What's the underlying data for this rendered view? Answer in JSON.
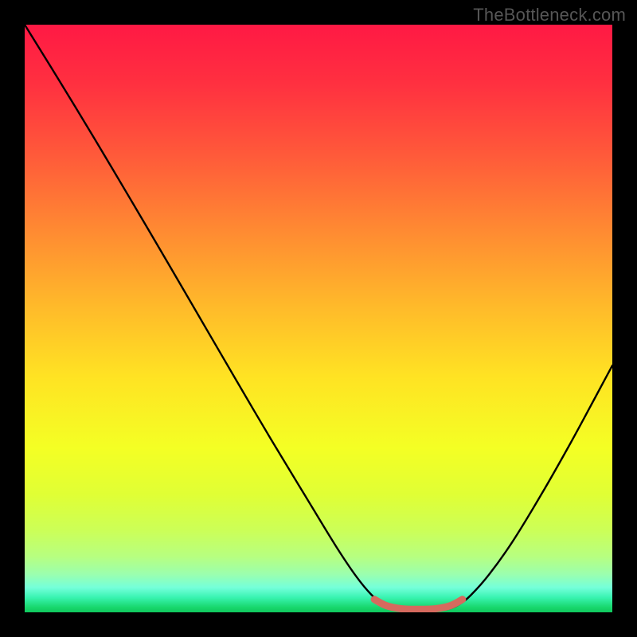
{
  "watermark": "TheBottleneck.com",
  "chart_data": {
    "type": "line",
    "title": "",
    "xlabel": "",
    "ylabel": "",
    "xlim": [
      0,
      100
    ],
    "ylim": [
      0,
      100
    ],
    "grid": false,
    "background_gradient": [
      {
        "offset": 0.0,
        "color": "#ff1944"
      },
      {
        "offset": 0.1,
        "color": "#ff3040"
      },
      {
        "offset": 0.22,
        "color": "#ff593a"
      },
      {
        "offset": 0.35,
        "color": "#ff8a32"
      },
      {
        "offset": 0.48,
        "color": "#ffba2a"
      },
      {
        "offset": 0.6,
        "color": "#ffe323"
      },
      {
        "offset": 0.72,
        "color": "#f4ff24"
      },
      {
        "offset": 0.8,
        "color": "#e0ff35"
      },
      {
        "offset": 0.86,
        "color": "#ccff57"
      },
      {
        "offset": 0.905,
        "color": "#b7ff80"
      },
      {
        "offset": 0.935,
        "color": "#9bffae"
      },
      {
        "offset": 0.958,
        "color": "#74ffda"
      },
      {
        "offset": 0.975,
        "color": "#38f3b0"
      },
      {
        "offset": 0.992,
        "color": "#17d66b"
      },
      {
        "offset": 1.0,
        "color": "#11c85e"
      }
    ],
    "series": [
      {
        "name": "bottleneck-curve",
        "stroke": "#000000",
        "stroke_width": 2.4,
        "points": [
          {
            "x": 0.0,
            "y": 100.0
          },
          {
            "x": 6.0,
            "y": 90.3
          },
          {
            "x": 12.0,
            "y": 80.4
          },
          {
            "x": 18.0,
            "y": 70.3
          },
          {
            "x": 24.0,
            "y": 60.1
          },
          {
            "x": 30.0,
            "y": 49.8
          },
          {
            "x": 36.0,
            "y": 39.5
          },
          {
            "x": 42.0,
            "y": 29.3
          },
          {
            "x": 48.0,
            "y": 19.4
          },
          {
            "x": 53.0,
            "y": 11.2
          },
          {
            "x": 56.5,
            "y": 6.0
          },
          {
            "x": 59.0,
            "y": 3.0
          },
          {
            "x": 61.0,
            "y": 1.4
          },
          {
            "x": 63.0,
            "y": 0.55
          },
          {
            "x": 66.0,
            "y": 0.15
          },
          {
            "x": 69.0,
            "y": 0.15
          },
          {
            "x": 72.0,
            "y": 0.55
          },
          {
            "x": 74.0,
            "y": 1.4
          },
          {
            "x": 76.0,
            "y": 3.0
          },
          {
            "x": 79.0,
            "y": 6.4
          },
          {
            "x": 83.0,
            "y": 12.0
          },
          {
            "x": 88.0,
            "y": 20.2
          },
          {
            "x": 93.0,
            "y": 29.0
          },
          {
            "x": 97.0,
            "y": 36.4
          },
          {
            "x": 100.0,
            "y": 42.0
          }
        ]
      },
      {
        "name": "optimal-band",
        "stroke": "#d66a5e",
        "stroke_width": 9,
        "linecap": "round",
        "points": [
          {
            "x": 59.5,
            "y": 2.2
          },
          {
            "x": 61.5,
            "y": 1.15
          },
          {
            "x": 64.0,
            "y": 0.62
          },
          {
            "x": 67.0,
            "y": 0.5
          },
          {
            "x": 70.0,
            "y": 0.62
          },
          {
            "x": 72.5,
            "y": 1.15
          },
          {
            "x": 74.5,
            "y": 2.2
          }
        ]
      }
    ]
  }
}
